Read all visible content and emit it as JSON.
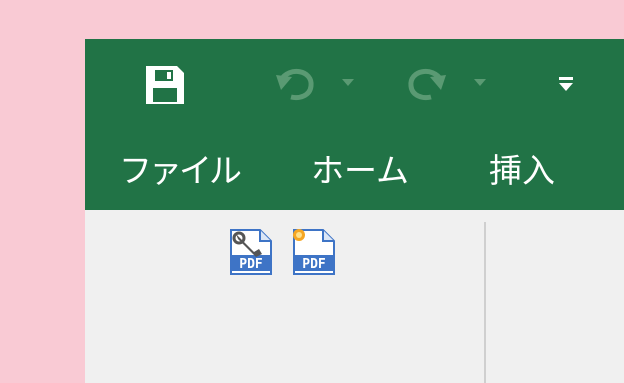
{
  "quick_access": {
    "save_icon": "save-icon",
    "undo_icon": "undo-icon",
    "redo_icon": "redo-icon",
    "customize_icon": "customize-qat-icon"
  },
  "tabs": [
    {
      "label": "ファイル"
    },
    {
      "label": "ホーム"
    },
    {
      "label": "挿入"
    }
  ],
  "ribbon": {
    "buttons": [
      {
        "icon": "pdf-settings-icon"
      },
      {
        "icon": "pdf-create-icon"
      }
    ]
  },
  "colors": {
    "accent": "#217346",
    "ribbon_bg": "#f0f0f0",
    "desktop_bg": "#f9cad4"
  }
}
